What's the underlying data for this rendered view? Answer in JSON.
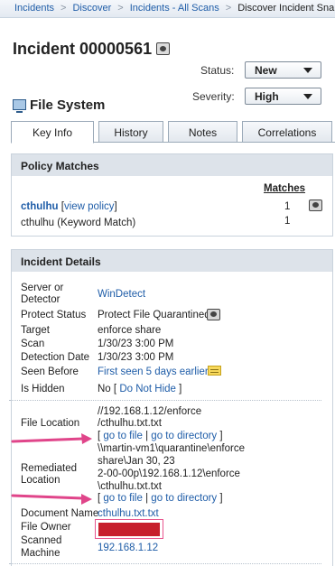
{
  "breadcrumb": {
    "items": [
      "Incidents",
      "Discover",
      "Incidents - All Scans"
    ],
    "current": "Discover Incident Snapsh"
  },
  "title": "Incident 00000561",
  "status": {
    "label": "Status:",
    "value": "New"
  },
  "severity": {
    "label": "Severity:",
    "value": "High"
  },
  "section_heading": "File System",
  "tabs": [
    "Key Info",
    "History",
    "Notes",
    "Correlations"
  ],
  "policy_matches": {
    "header": "Policy Matches",
    "matches_header": "Matches",
    "policy_name": "cthulhu",
    "view_policy_link": "view policy",
    "bracket_open": "[",
    "bracket_close": "]",
    "policy_count": "1",
    "rule": "cthulhu (Keyword Match)",
    "rule_count": "1"
  },
  "incident_details": {
    "header": "Incident Details",
    "server_label_1": "Server or",
    "server_label_2": "Detector",
    "server_value": "WinDetect",
    "protect_label": "Protect Status",
    "protect_value": "Protect File Quarantined",
    "target_label": "Target",
    "target_value": "enforce share",
    "scan_label": "Scan",
    "scan_value": "1/30/23 3:00 PM",
    "detection_label": "Detection Date",
    "detection_value": "1/30/23 3:00 PM",
    "seen_label": "Seen Before",
    "seen_value": "First seen 5 days earlier.",
    "hidden_label": "Is Hidden",
    "hidden_value": "No",
    "hidden_link": "Do Not Hide",
    "file_location_label": "File Location",
    "file_location_lines": [
      "//192.168.1.12/enforce",
      "/cthulhu.txt.txt"
    ],
    "go_to_file": "go to file",
    "go_to_directory": "go to directory",
    "link_sep": "|",
    "remediated_label_1": "Remediated",
    "remediated_label_2": "Location",
    "remediated_lines": [
      "\\\\martin-vm1\\quarantine\\enforce",
      "share\\Jan 30, 23",
      "2-00-00p\\192.168.1.12\\enforce",
      "\\cthulhu.txt.txt"
    ],
    "document_label": "Document Name",
    "document_value": "cthulhu.txt.txt",
    "owner_label": "File Owner",
    "scanned_label_1": "Scanned",
    "scanned_label_2": "Machine",
    "scanned_value": "192.168.1.12"
  },
  "colors": {
    "link": "#1f5da8",
    "panel_header": "#dde3ea",
    "arrow": "#e0458a",
    "redaction": "#c71f2c"
  }
}
